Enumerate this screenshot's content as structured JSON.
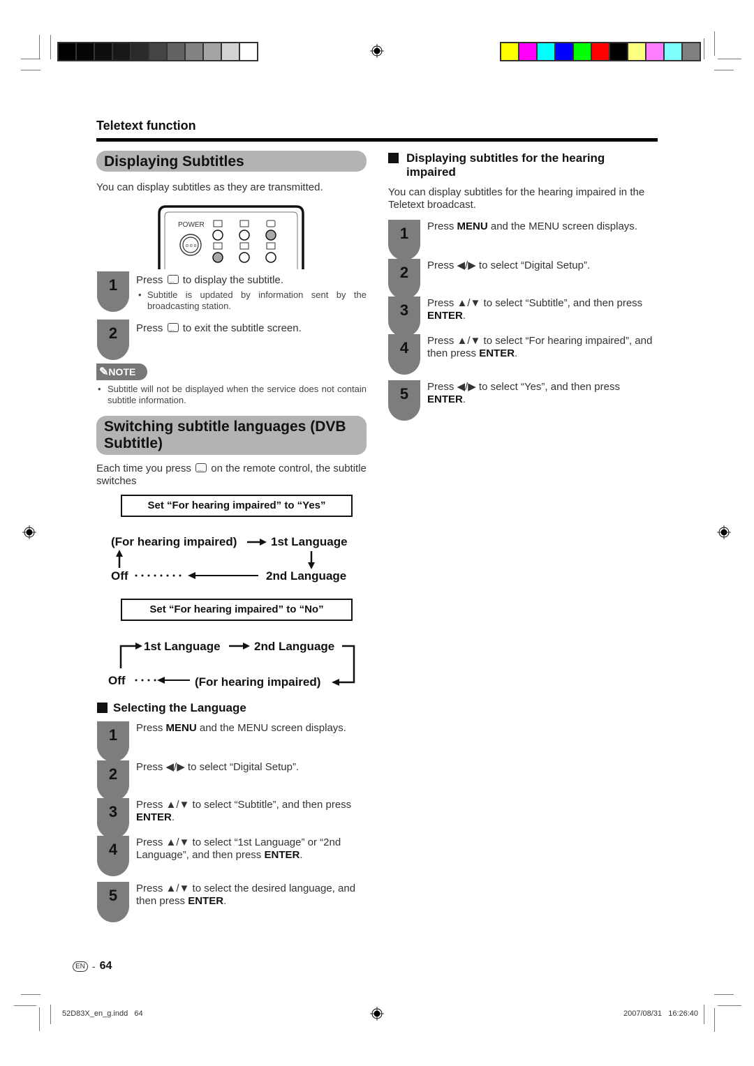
{
  "print_marks": {
    "grayscale_swatches": [
      "#000000",
      "#050505",
      "#0e0e0e",
      "#181818",
      "#2a2a2a",
      "#444444",
      "#636363",
      "#838383",
      "#a4a4a4",
      "#d2d2d2",
      "#ffffff"
    ],
    "color_swatches": [
      "#ffff00",
      "#ff00ff",
      "#00ffff",
      "#0000ff",
      "#00ff00",
      "#ff0000",
      "#000000",
      "#ffff80",
      "#ff80ff",
      "#80ffff",
      "#808080"
    ],
    "slug_left": "52D83X_en_g.indd   64",
    "slug_right": "2007/08/31   16:26:40"
  },
  "header": {
    "section": "Teletext function"
  },
  "left": {
    "title1": "Displaying Subtitles",
    "intro1": "You can display subtitles as they are transmitted.",
    "remote": {
      "power_label": "POWER",
      "icons": [
        "teletext-icon",
        "reveal-icon",
        "subtitle-icon",
        "size-icon",
        "mix-icon",
        "hold-icon"
      ]
    },
    "steps1": [
      {
        "num": "1",
        "pre": "Press",
        "post": "to display the subtitle.",
        "bullet": "Subtitle is updated by information sent by the broadcasting station."
      },
      {
        "num": "2",
        "pre": "Press",
        "post": "to exit the subtitle screen."
      }
    ],
    "note_label": "NOTE",
    "note_text": "Subtitle will not be displayed when the service does not contain subtitle information.",
    "title2": "Switching subtitle languages (DVB Subtitle)",
    "intro2_pre": "Each time you press",
    "intro2_post": "on the remote control, the subtitle switches",
    "box_yes": "Set “For hearing impaired” to “Yes”",
    "flow_yes": {
      "hi": "(For hearing impaired)",
      "l1": "1st Language",
      "off": "Off",
      "l2": "2nd Language"
    },
    "box_no": "Set “For hearing impaired” to “No”",
    "flow_no": {
      "l1": "1st Language",
      "l2": "2nd Language",
      "off": "Off",
      "hi": "(For hearing impaired)"
    },
    "subhead": "Selecting the Language",
    "steps2": [
      {
        "num": "1",
        "a": "Press ",
        "b": "MENU",
        "c": " and the MENU screen displays."
      },
      {
        "num": "2",
        "a": "Press ◀/▶ to select “Digital Setup”.",
        "b": "",
        "c": ""
      },
      {
        "num": "3",
        "a": "Press ▲/▼ to select “Subtitle”, and then press ",
        "b": "ENTER",
        "c": "."
      },
      {
        "num": "4",
        "a": "Press ▲/▼ to select “1st Language” or “2nd Language”, and then press ",
        "b": "ENTER",
        "c": "."
      },
      {
        "num": "5",
        "a": "Press ▲/▼ to select the desired language, and then press ",
        "b": "ENTER",
        "c": "."
      }
    ]
  },
  "right": {
    "subhead": "Displaying subtitles for the hearing impaired",
    "intro": "You can display subtitles for the hearing impaired in the Teletext broadcast.",
    "steps": [
      {
        "num": "1",
        "a": "Press ",
        "b": "MENU",
        "c": " and the MENU screen displays."
      },
      {
        "num": "2",
        "a": "Press ◀/▶ to select “Digital Setup”.",
        "b": "",
        "c": ""
      },
      {
        "num": "3",
        "a": "Press ▲/▼ to select “Subtitle”, and then press ",
        "b": "ENTER",
        "c": "."
      },
      {
        "num": "4",
        "a": "Press ▲/▼ to select “For hearing impaired”, and then press ",
        "b": "ENTER",
        "c": "."
      },
      {
        "num": "5",
        "a": "Press ◀/▶ to select “Yes”, and then press ",
        "b": "ENTER",
        "c": "."
      }
    ]
  },
  "footer": {
    "lang": "EN",
    "sep": "-",
    "page": "64"
  }
}
